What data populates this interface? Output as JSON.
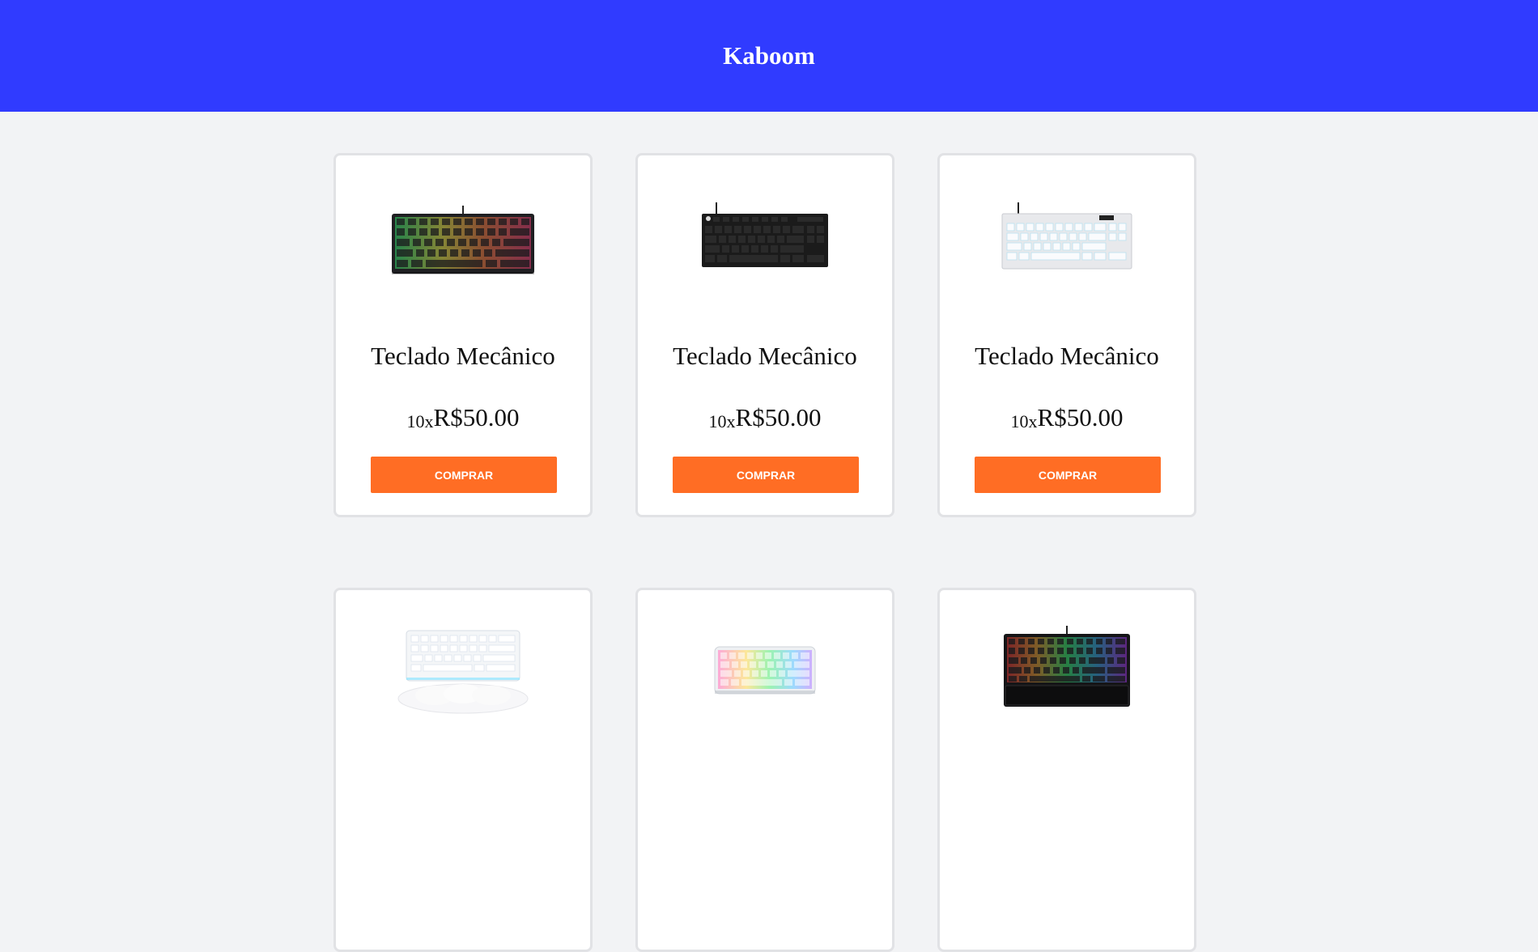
{
  "header": {
    "title": "Kaboom"
  },
  "products": [
    {
      "name": "Teclado Mecânico",
      "installments": "10x",
      "price": "R$50.00",
      "buy_label": "COMPRAR",
      "image": "keyboard-tkl-rgb-dark"
    },
    {
      "name": "Teclado Mecânico",
      "installments": "10x",
      "price": "R$50.00",
      "buy_label": "COMPRAR",
      "image": "keyboard-tkl-black"
    },
    {
      "name": "Teclado Mecânico",
      "installments": "10x",
      "price": "R$50.00",
      "buy_label": "COMPRAR",
      "image": "keyboard-tkl-white"
    },
    {
      "name": "",
      "installments": "",
      "price": "",
      "buy_label": "",
      "image": "keyboard-white-wrist-rest"
    },
    {
      "name": "",
      "installments": "",
      "price": "",
      "buy_label": "",
      "image": "keyboard-transparent-rgb"
    },
    {
      "name": "",
      "installments": "",
      "price": "",
      "buy_label": "",
      "image": "keyboard-full-rgb-black"
    }
  ],
  "colors": {
    "header_bg": "#303bff",
    "button_bg": "#ff6d24",
    "page_bg": "#f2f3f5"
  }
}
